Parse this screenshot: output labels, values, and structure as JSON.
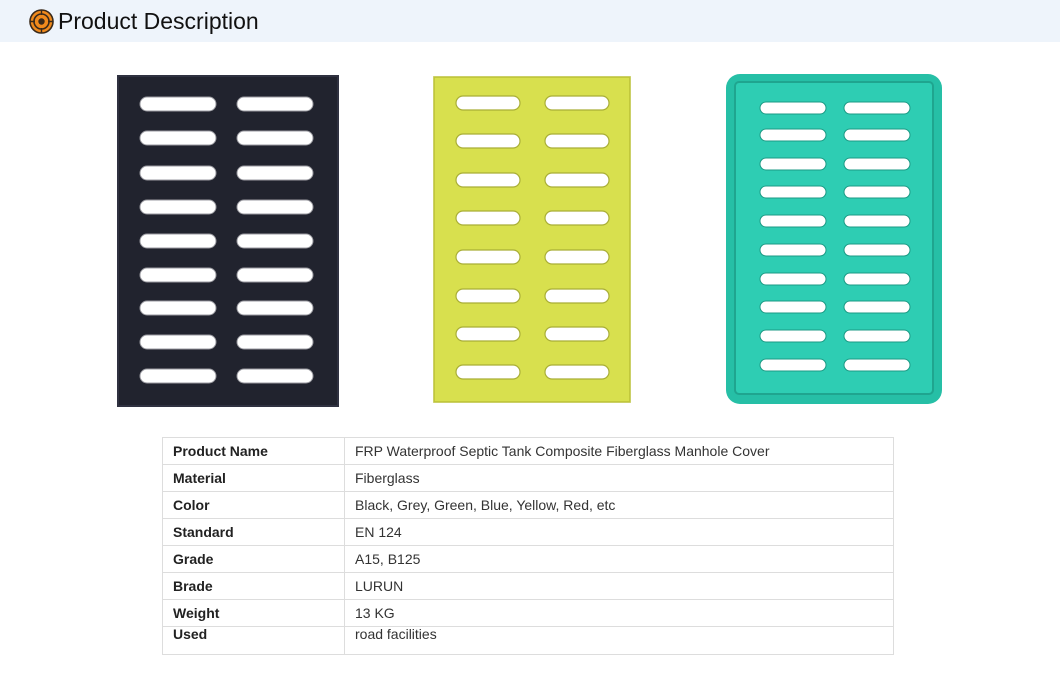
{
  "header": {
    "title": "Product Description",
    "icon": "target-badge-icon",
    "accent_color": "#f08a1c"
  },
  "images": [
    {
      "name": "black-manhole-cover",
      "color": "#21232e"
    },
    {
      "name": "yellow-manhole-cover",
      "color": "#d8e04e"
    },
    {
      "name": "green-manhole-cover",
      "color": "#2ec9b0"
    }
  ],
  "specs": [
    {
      "key": "Product Name",
      "value": "FRP Waterproof Septic Tank Composite Fiberglass Manhole Cover"
    },
    {
      "key": "Material",
      "value": "Fiberglass"
    },
    {
      "key": "Color",
      "value": "Black, Grey, Green, Blue, Yellow, Red, etc"
    },
    {
      "key": "Standard",
      "value": "EN 124"
    },
    {
      "key": "Grade",
      "value": "A15, B125"
    },
    {
      "key": "Brade",
      "value": "LURUN"
    },
    {
      "key": "Weight",
      "value": "13 KG"
    },
    {
      "key": "Used",
      "value": "road facilities"
    }
  ]
}
